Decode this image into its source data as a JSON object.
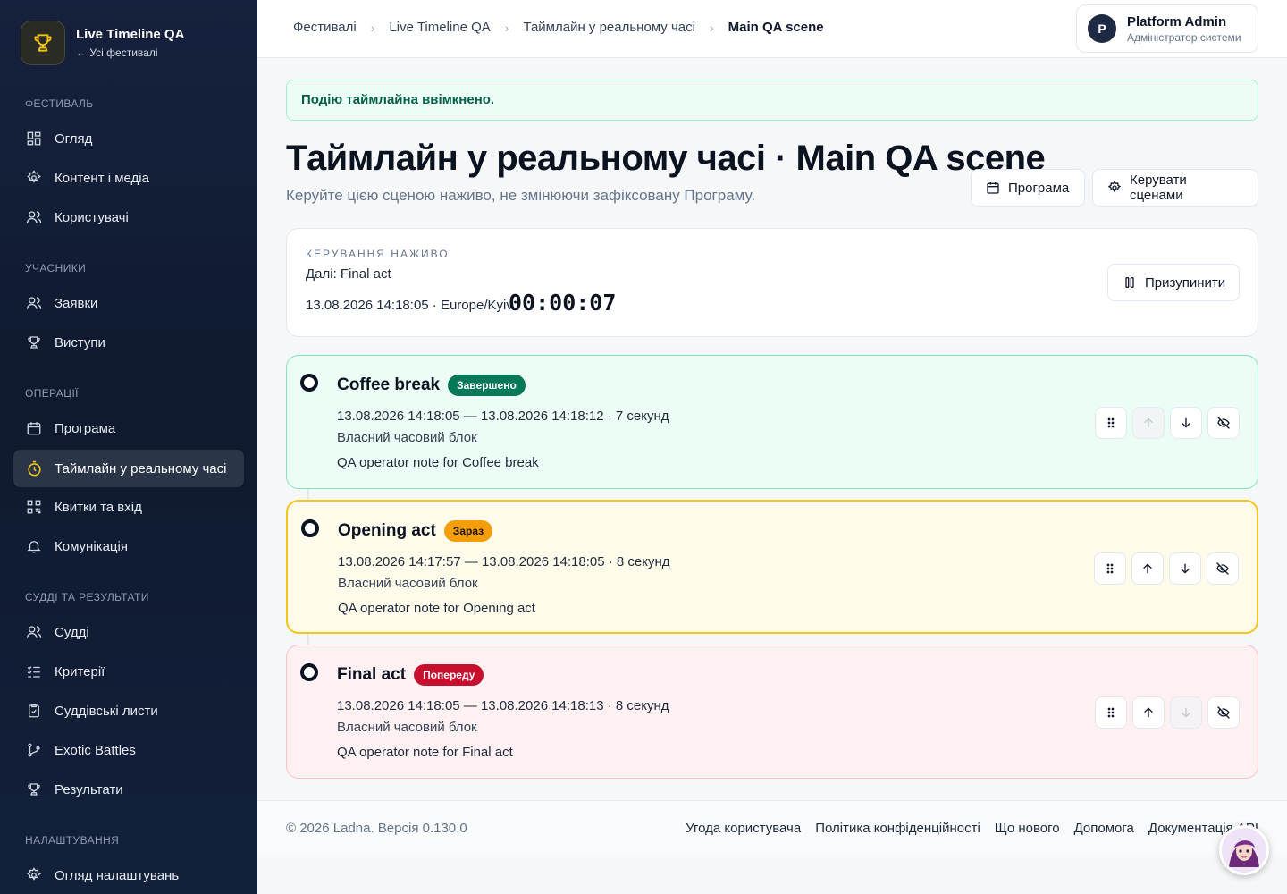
{
  "sidebar": {
    "brand_title": "Live Timeline QA",
    "brand_back": "← Усі фестивалі",
    "sections": {
      "festival": "ФЕСТИВАЛЬ",
      "participants": "УЧАСНИКИ",
      "operations": "ОПЕРАЦІЇ",
      "judging": "СУДДІ ТА РЕЗУЛЬТАТИ",
      "settings": "НАЛАШТУВАННЯ"
    },
    "items": {
      "overview": "Огляд",
      "content": "Контент і медіа",
      "users": "Користувачі",
      "applications": "Заявки",
      "performances": "Виступи",
      "program": "Програма",
      "live_timeline": "Таймлайн у реальному часі",
      "tickets": "Квитки та вхід",
      "communication": "Комунікація",
      "judges": "Судді",
      "criteria": "Критерії",
      "score_sheets": "Суддівські листи",
      "exotic_battles": "Exotic Battles",
      "results": "Результати",
      "settings_overview": "Огляд налаштувань"
    }
  },
  "breadcrumb": [
    "Фестивалі",
    "Live Timeline QA",
    "Таймлайн у реальному часі",
    "Main QA scene"
  ],
  "user": {
    "initial": "P",
    "name": "Platform Admin",
    "role": "Адміністратор системи"
  },
  "alert": "Подію таймлайна ввімкнено.",
  "page": {
    "title": "Таймлайн у реальному часі · Main QA scene",
    "subtitle": "Керуйте цією сценою наживо, не змінюючи зафіксовану Програму.",
    "program_button": "Програма",
    "scenes_button": "Керувати сценами"
  },
  "live": {
    "label": "КЕРУВАННЯ НАЖИВО",
    "next": "Далі: Final act",
    "datetime": "13.08.2026 14:18:05 · Europe/Kyiv",
    "clock": "00:00:07",
    "pause_button": "Призупинити"
  },
  "slots": [
    {
      "name": "Coffee break",
      "status": "Завершено",
      "range": "13.08.2026 14:18:05 — 13.08.2026 14:18:12 · 7 секунд",
      "kind": "Власний часовий блок",
      "note": "QA operator note for Coffee break",
      "colors": {
        "bg": "#ecfdf5",
        "border": "#86e0bd",
        "badge": "#047857"
      }
    },
    {
      "name": "Opening act",
      "status": "Зараз",
      "range": "13.08.2026 14:17:57 — 13.08.2026 14:18:05 · 8 секунд",
      "kind": "Власний часовий блок",
      "note": "QA operator note for Opening act",
      "colors": {
        "bg": "#fffbeb",
        "border": "#f5c518",
        "badge": "#f59e0b"
      }
    },
    {
      "name": "Final act",
      "status": "Попереду",
      "range": "13.08.2026 14:18:05 — 13.08.2026 14:18:13 · 8 секунд",
      "kind": "Власний часовий блок",
      "note": "QA operator note for Final act",
      "colors": {
        "bg": "#fff1f2",
        "border": "#fbc0c8",
        "badge": "#c8102e"
      }
    }
  ],
  "footer": {
    "copyright": "© 2026 Ladna. Версія 0.130.0",
    "links": [
      "Угода користувача",
      "Політика конфіденційності",
      "Що нового",
      "Допомога",
      "Документація API"
    ]
  }
}
